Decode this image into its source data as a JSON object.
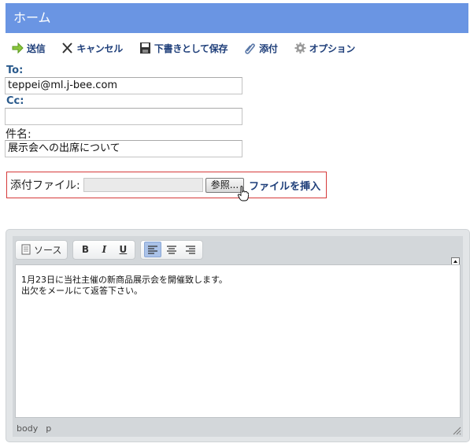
{
  "header": {
    "title": "ホーム"
  },
  "toolbar": {
    "send": "送信",
    "cancel": "キャンセル",
    "save_draft": "下書きとして保存",
    "attach": "添付",
    "options": "オプション"
  },
  "form": {
    "to_label": "To:",
    "to_value": "teppei@ml.j-bee.com",
    "cc_label": "Cc:",
    "cc_value": "",
    "subject_label": "件名:",
    "subject_value": "展示会への出席について"
  },
  "attachment": {
    "label": "添付ファイル:",
    "browse_label": "参照...",
    "insert_label": "ファイルを挿入"
  },
  "editor": {
    "source_label": "ソース",
    "bold_label": "B",
    "italic_label": "I",
    "underline_label": "U",
    "body_lines": [
      "1月23日に当社主催の新商品展示会を開催致します。",
      "出欠をメールにて返答下さい。"
    ],
    "path": [
      "body",
      "p"
    ]
  },
  "colors": {
    "header_bg": "#6a95e3",
    "link": "#1f3f7a",
    "attach_border": "#d63a3a",
    "active_align": "#aac2e8"
  }
}
